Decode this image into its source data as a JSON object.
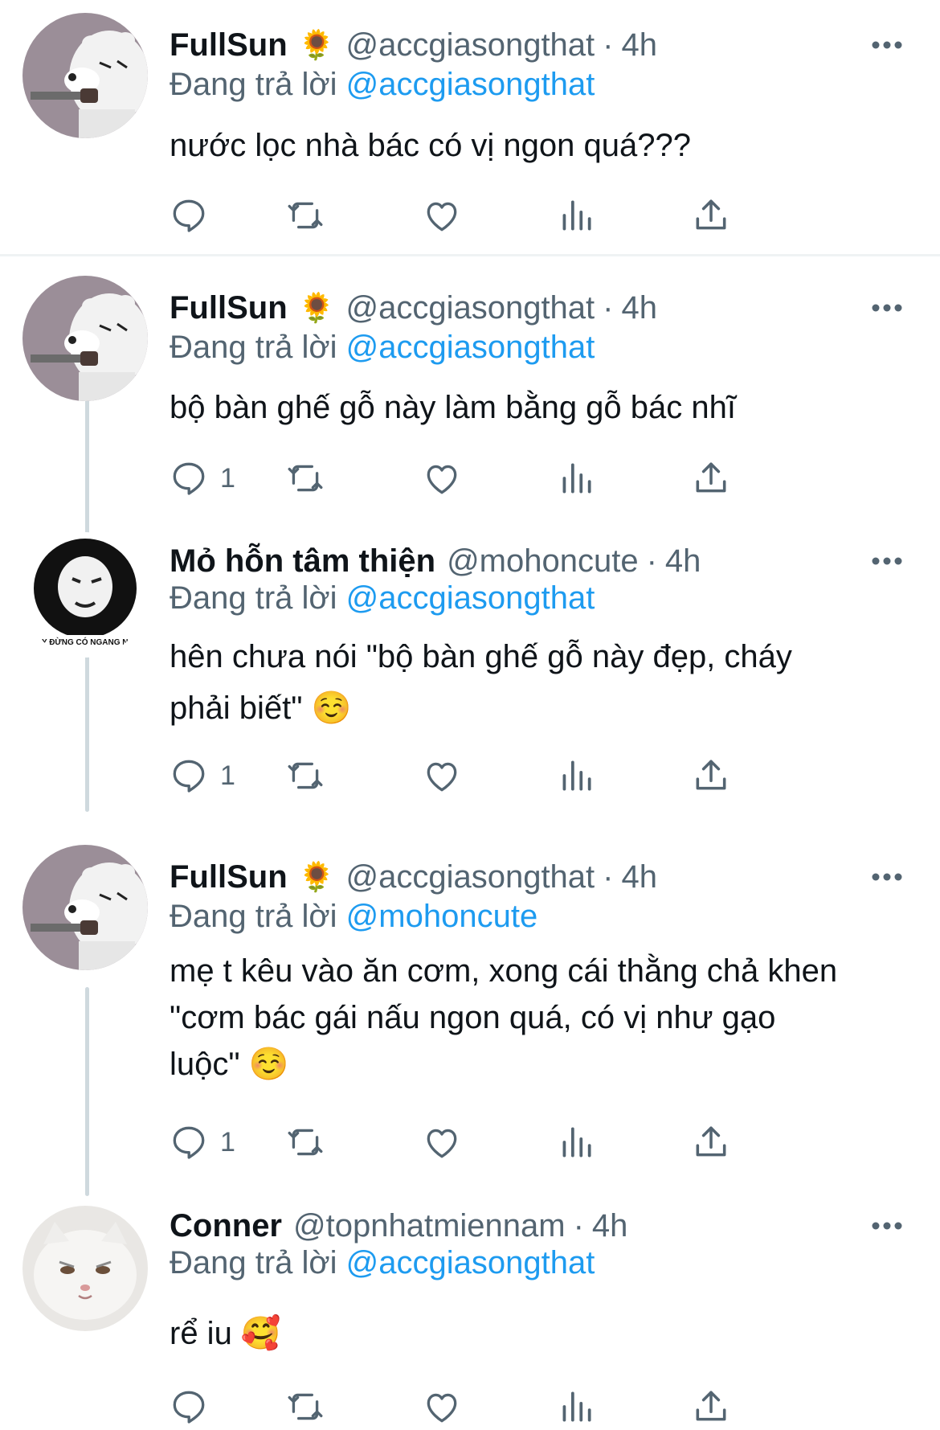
{
  "colors": {
    "text": "#0f1419",
    "secondary": "#536471",
    "link": "#1d9bf0",
    "thread_line": "#cfd9de",
    "divider": "#eff3f4"
  },
  "icons": {
    "reply": "speech-bubble-icon",
    "retweet": "retweet-arrows-icon",
    "like": "heart-icon",
    "views": "bar-chart-icon",
    "share": "upload-arrow-icon",
    "more": "three-dots-icon",
    "badge": "sunflower-emoji"
  },
  "tweets": [
    {
      "display_name": "FullSun",
      "badge": "🌻",
      "handle": "@accgiasongthat",
      "separator": "·",
      "time": "4h",
      "replying_prefix": "Đang trả lời",
      "replying_to": "@accgiasongthat",
      "text": "nước lọc nhà bác có vị ngon quá???",
      "reply_count": ""
    },
    {
      "display_name": "FullSun",
      "badge": "🌻",
      "handle": "@accgiasongthat",
      "separator": "·",
      "time": "4h",
      "replying_prefix": "Đang trả lời",
      "replying_to": "@accgiasongthat",
      "text": "bộ bàn ghế gỗ này làm bằng gỗ bác nhĩ",
      "reply_count": "1"
    },
    {
      "display_name": "Mỏ hỗn tâm thiện",
      "badge": "",
      "handle": "@mohoncute",
      "separator": "·",
      "time": "4h",
      "replying_prefix": "Đang trả lời",
      "replying_to": "@accgiasongthat",
      "text": "hên chưa nói \"bộ bàn ghế gỗ này đẹp, cháy\nphải biết\" ☺️",
      "reply_count": "1",
      "avatar_caption": "MÀY ĐỪNG CÓ NGANG NGƯ"
    },
    {
      "display_name": "FullSun",
      "badge": "🌻",
      "handle": "@accgiasongthat",
      "separator": "·",
      "time": "4h",
      "replying_prefix": "Đang trả lời",
      "replying_to": "@mohoncute",
      "text": "mẹ t kêu vào ăn cơm, xong cái thằng chả khen\n\"cơm bác gái nấu ngon quá, có vị như gạo\nluộc\" ☺️",
      "reply_count": "1"
    },
    {
      "display_name": "Conner",
      "badge": "",
      "handle": "@topnhatmiennam",
      "separator": "·",
      "time": "4h",
      "replying_prefix": "Đang trả lời",
      "replying_to": "@accgiasongthat",
      "text": "rể iu 🥰",
      "reply_count": ""
    }
  ]
}
